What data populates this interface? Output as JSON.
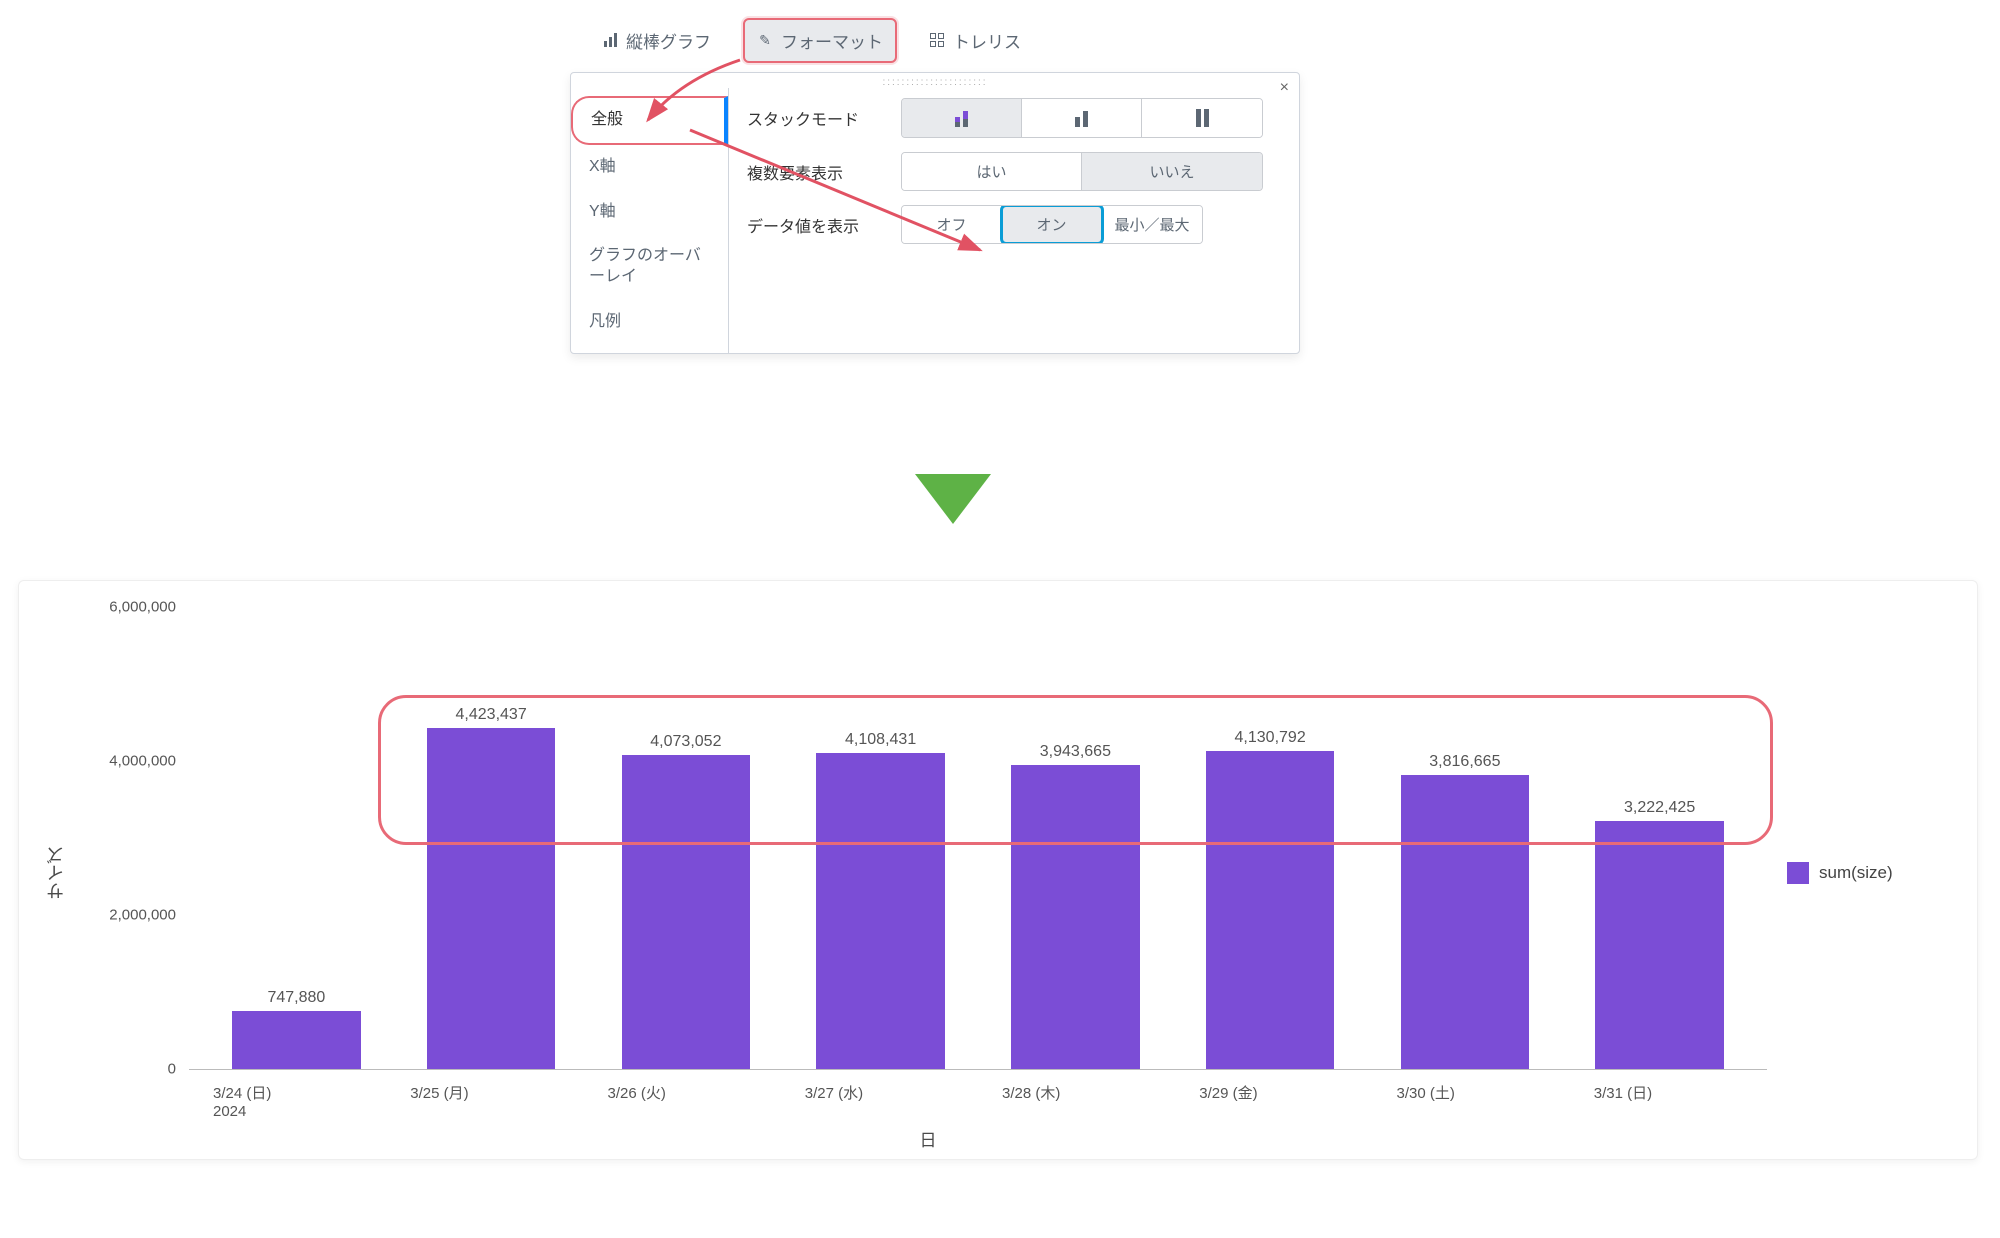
{
  "config_tabs": {
    "bar_chart": "縦棒グラフ",
    "format": "フォーマット",
    "trellis": "トレリス"
  },
  "panel": {
    "close": "×",
    "drag_handle": "::::::::::::::::::::::",
    "side_items": [
      "全般",
      "X軸",
      "Y軸",
      "グラフのオーバーレイ",
      "凡例"
    ],
    "rows": {
      "stack_mode_label": "スタックモード",
      "multi_label": "複数要素表示",
      "multi_yes": "はい",
      "multi_no": "いいえ",
      "dataval_label": "データ値を表示",
      "dataval_off": "オフ",
      "dataval_on": "オン",
      "dataval_minmax": "最小／最大"
    }
  },
  "legend": {
    "label": "sum(size)"
  },
  "axes": {
    "xlabel": "日",
    "ylabel": "サイズ"
  },
  "chart_data": {
    "type": "bar",
    "title": "",
    "xlabel": "日",
    "ylabel": "サイズ",
    "ylim": [
      0,
      6000000
    ],
    "y_ticks": [
      0,
      2000000,
      4000000,
      6000000
    ],
    "y_tick_labels": [
      "0",
      "2,000,000",
      "4,000,000",
      "6,000,000"
    ],
    "categories": [
      "3/24 (日)\n2024",
      "3/25 (月)",
      "3/26 (火)",
      "3/27 (水)",
      "3/28 (木)",
      "3/29 (金)",
      "3/30 (土)",
      "3/31 (日)"
    ],
    "values": [
      747880,
      4423437,
      4073052,
      4108431,
      3943665,
      4130792,
      3816665,
      3222425
    ],
    "value_labels": [
      "747,880",
      "4,423,437",
      "4,073,052",
      "4,108,431",
      "3,943,665",
      "4,130,792",
      "3,816,665",
      "3,222,425"
    ],
    "series": [
      {
        "name": "sum(size)",
        "color": "#7b4dd6"
      }
    ],
    "legend_position": "right"
  }
}
